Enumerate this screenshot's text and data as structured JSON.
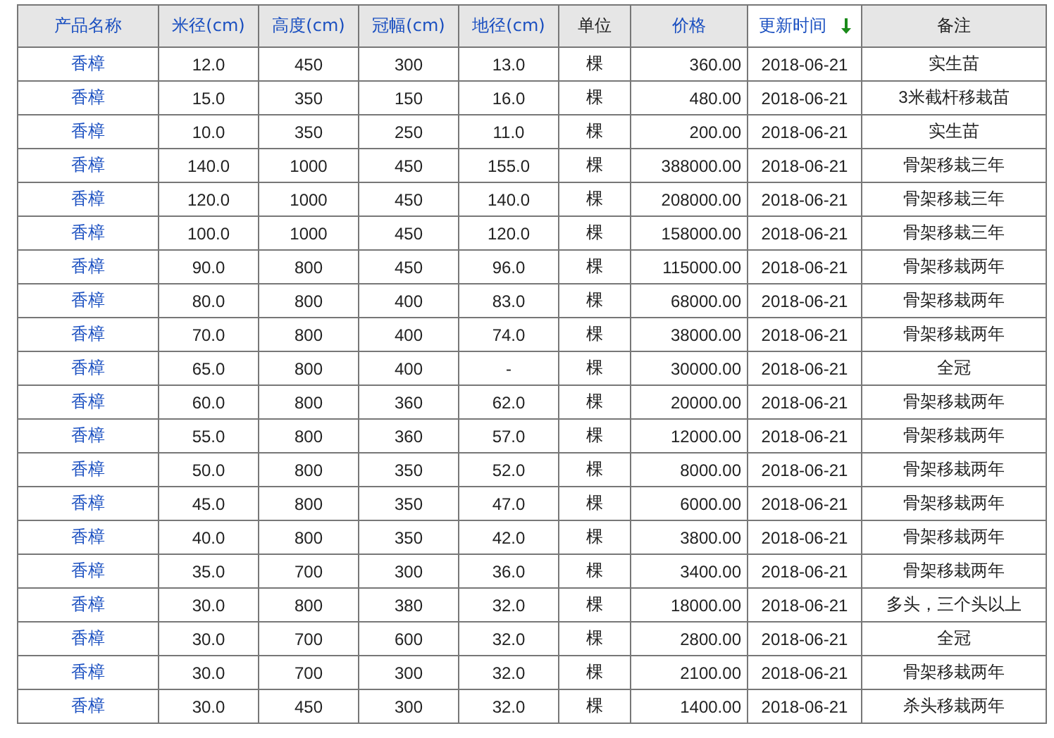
{
  "table": {
    "columns": [
      {
        "label": "产品名称",
        "kind": "link",
        "sorted": false
      },
      {
        "label": "米径(cm)",
        "kind": "link",
        "sorted": false
      },
      {
        "label": "高度(cm)",
        "kind": "link",
        "sorted": false
      },
      {
        "label": "冠幅(cm)",
        "kind": "link",
        "sorted": false
      },
      {
        "label": "地径(cm)",
        "kind": "link",
        "sorted": false
      },
      {
        "label": "单位",
        "kind": "text",
        "sorted": false
      },
      {
        "label": "价格",
        "kind": "link",
        "sorted": false
      },
      {
        "label": "更新时间",
        "kind": "link",
        "sorted": true
      },
      {
        "label": "备注",
        "kind": "text",
        "sorted": false
      }
    ],
    "rows": [
      [
        "香樟",
        "12.0",
        "450",
        "300",
        "13.0",
        "棵",
        "360.00",
        "2018-06-21",
        "实生苗"
      ],
      [
        "香樟",
        "15.0",
        "350",
        "150",
        "16.0",
        "棵",
        "480.00",
        "2018-06-21",
        "3米截杆移栽苗"
      ],
      [
        "香樟",
        "10.0",
        "350",
        "250",
        "11.0",
        "棵",
        "200.00",
        "2018-06-21",
        "实生苗"
      ],
      [
        "香樟",
        "140.0",
        "1000",
        "450",
        "155.0",
        "棵",
        "388000.00",
        "2018-06-21",
        "骨架移栽三年"
      ],
      [
        "香樟",
        "120.0",
        "1000",
        "450",
        "140.0",
        "棵",
        "208000.00",
        "2018-06-21",
        "骨架移栽三年"
      ],
      [
        "香樟",
        "100.0",
        "1000",
        "450",
        "120.0",
        "棵",
        "158000.00",
        "2018-06-21",
        "骨架移栽三年"
      ],
      [
        "香樟",
        "90.0",
        "800",
        "450",
        "96.0",
        "棵",
        "115000.00",
        "2018-06-21",
        "骨架移栽两年"
      ],
      [
        "香樟",
        "80.0",
        "800",
        "400",
        "83.0",
        "棵",
        "68000.00",
        "2018-06-21",
        "骨架移栽两年"
      ],
      [
        "香樟",
        "70.0",
        "800",
        "400",
        "74.0",
        "棵",
        "38000.00",
        "2018-06-21",
        "骨架移栽两年"
      ],
      [
        "香樟",
        "65.0",
        "800",
        "400",
        "-",
        "棵",
        "30000.00",
        "2018-06-21",
        "全冠"
      ],
      [
        "香樟",
        "60.0",
        "800",
        "360",
        "62.0",
        "棵",
        "20000.00",
        "2018-06-21",
        "骨架移栽两年"
      ],
      [
        "香樟",
        "55.0",
        "800",
        "360",
        "57.0",
        "棵",
        "12000.00",
        "2018-06-21",
        "骨架移栽两年"
      ],
      [
        "香樟",
        "50.0",
        "800",
        "350",
        "52.0",
        "棵",
        "8000.00",
        "2018-06-21",
        "骨架移栽两年"
      ],
      [
        "香樟",
        "45.0",
        "800",
        "350",
        "47.0",
        "棵",
        "6000.00",
        "2018-06-21",
        "骨架移栽两年"
      ],
      [
        "香樟",
        "40.0",
        "800",
        "350",
        "42.0",
        "棵",
        "3800.00",
        "2018-06-21",
        "骨架移栽两年"
      ],
      [
        "香樟",
        "35.0",
        "700",
        "300",
        "36.0",
        "棵",
        "3400.00",
        "2018-06-21",
        "骨架移栽两年"
      ],
      [
        "香樟",
        "30.0",
        "800",
        "380",
        "32.0",
        "棵",
        "18000.00",
        "2018-06-21",
        "多头，三个头以上"
      ],
      [
        "香樟",
        "30.0",
        "700",
        "600",
        "32.0",
        "棵",
        "2800.00",
        "2018-06-21",
        "全冠"
      ],
      [
        "香樟",
        "30.0",
        "700",
        "300",
        "32.0",
        "棵",
        "2100.00",
        "2018-06-21",
        "骨架移栽两年"
      ],
      [
        "香樟",
        "30.0",
        "450",
        "300",
        "32.0",
        "棵",
        "1400.00",
        "2018-06-21",
        "杀头移栽两年"
      ]
    ]
  }
}
